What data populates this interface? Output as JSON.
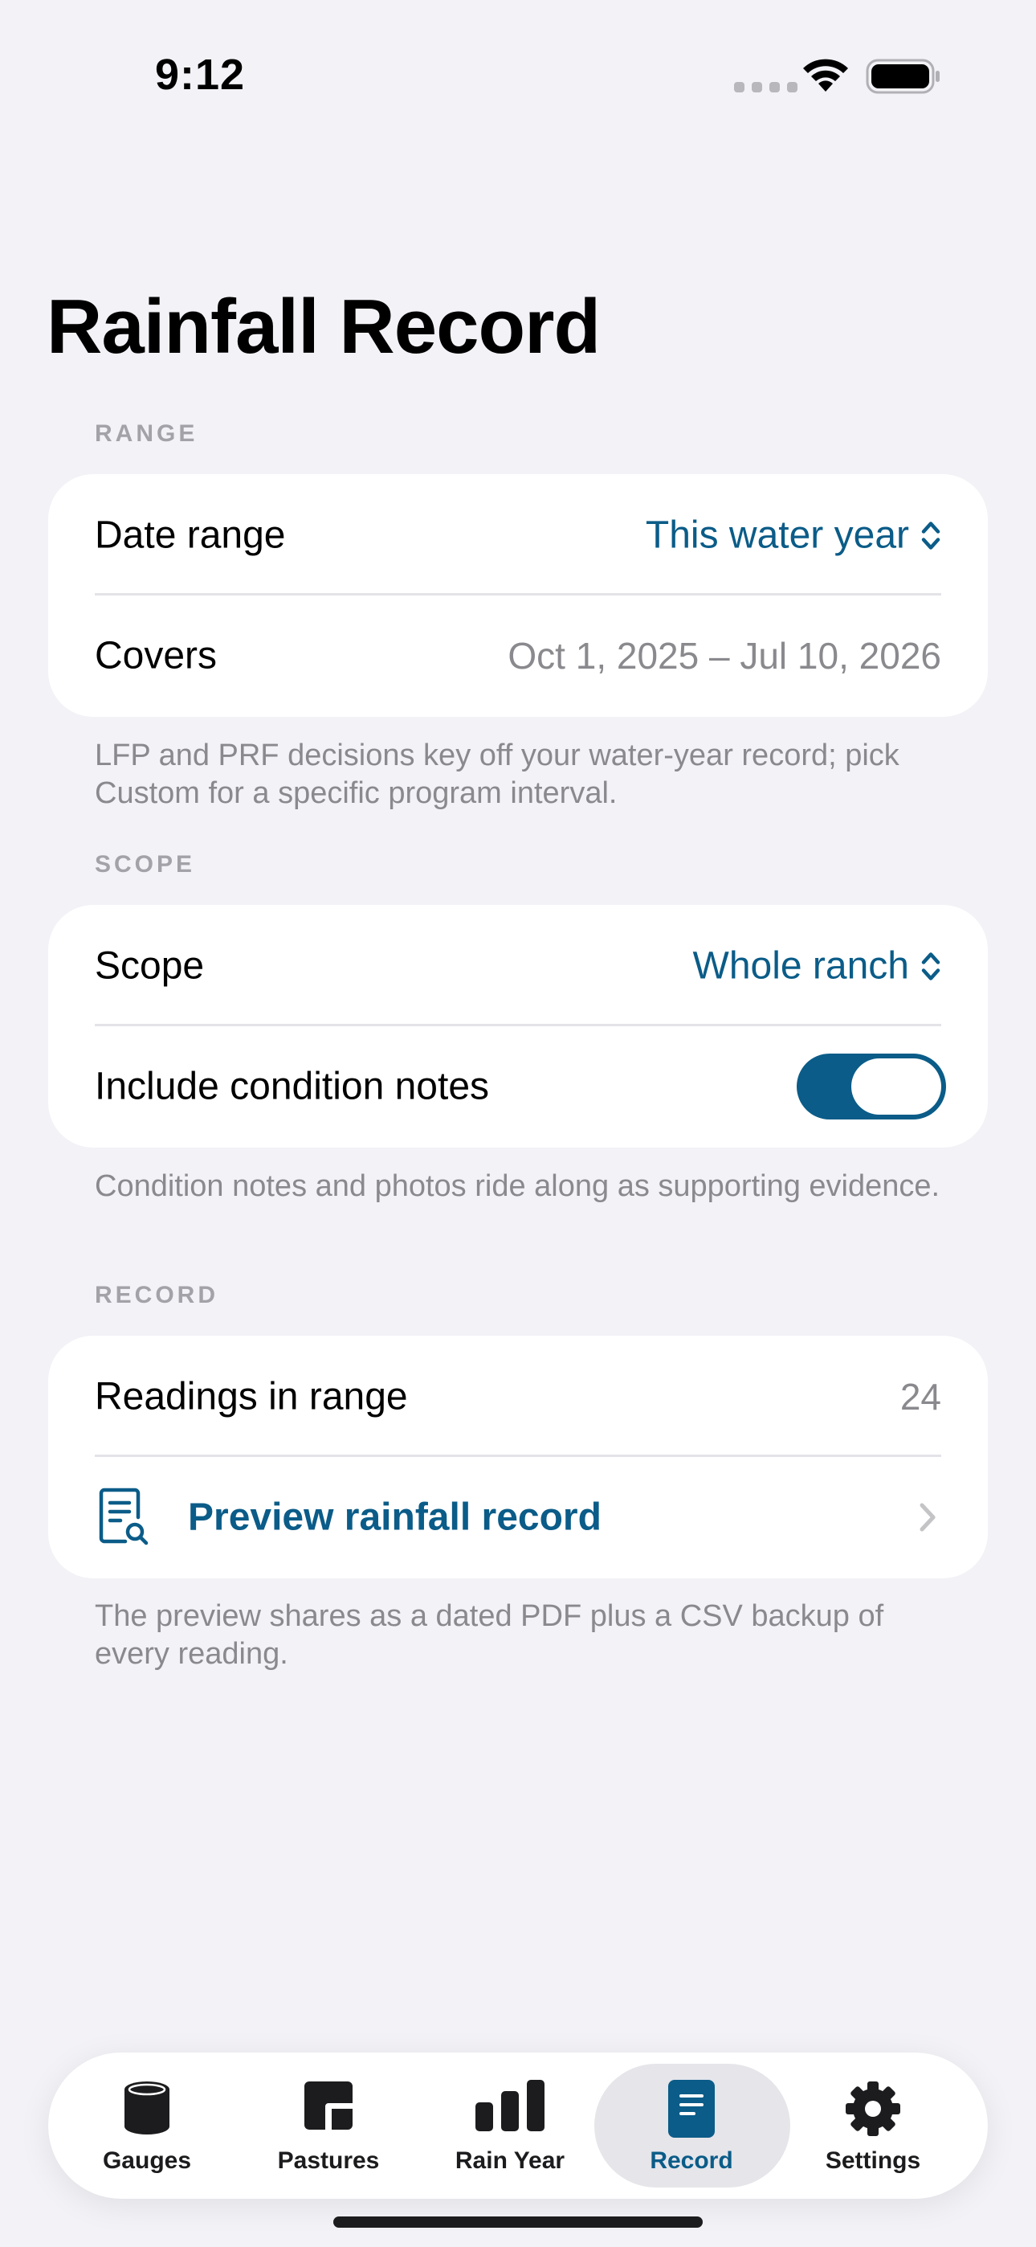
{
  "status": {
    "time": "9:12"
  },
  "page": {
    "title": "Rainfall Record"
  },
  "range": {
    "header": "RANGE",
    "date_range_label": "Date range",
    "date_range_value": "This water year",
    "covers_label": "Covers",
    "covers_value": "Oct 1, 2025 – Jul 10, 2026",
    "note": "LFP and PRF decisions key off your water-year record; pick Custom for a specific program interval."
  },
  "scope": {
    "header": "SCOPE",
    "scope_label": "Scope",
    "scope_value": "Whole ranch",
    "notes_label": "Include condition notes",
    "notes_enabled": true,
    "note": "Condition notes and photos ride along as supporting evidence."
  },
  "record": {
    "header": "RECORD",
    "readings_label": "Readings in range",
    "readings_value": "24",
    "preview_label": "Preview rainfall record",
    "note": "The preview shares as a dated PDF plus a CSV backup of every reading."
  },
  "tabs": [
    {
      "label": "Gauges",
      "icon": "gauge-cylinder-icon"
    },
    {
      "label": "Pastures",
      "icon": "pastures-icon"
    },
    {
      "label": "Rain Year",
      "icon": "bar-chart-icon"
    },
    {
      "label": "Record",
      "icon": "record-document-icon",
      "active": true
    },
    {
      "label": "Settings",
      "icon": "gear-icon"
    }
  ],
  "colors": {
    "accent": "#0b5c88",
    "background": "#f2f2f7",
    "card": "#ffffff",
    "secondary_text": "#8a8a8e"
  }
}
